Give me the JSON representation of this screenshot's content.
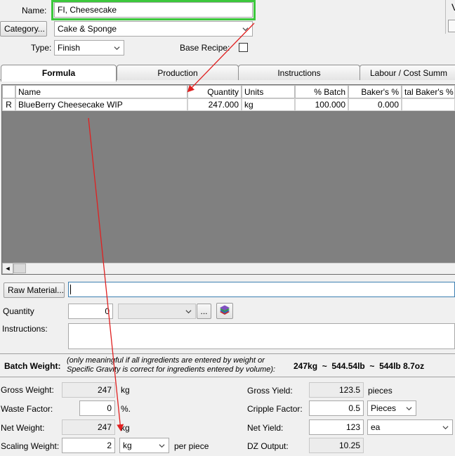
{
  "header": {
    "name_label": "Name:",
    "name_value": "FI, Cheesecake",
    "category_button": "Category...",
    "category_value": "Cake & Sponge",
    "type_label": "Type:",
    "type_value": "Finish",
    "base_recipe_label": "Base Recipe:",
    "base_recipe_checked": false
  },
  "tabs": [
    "Formula",
    "Production",
    "Instructions",
    "Labour / Cost Summ"
  ],
  "grid": {
    "columns": [
      "Name",
      "Quantity",
      "Units",
      "% Batch",
      "Baker's %",
      "tal Baker's %"
    ],
    "rows": [
      {
        "marker": "R",
        "name": "BlueBerry Cheesecake WIP",
        "quantity": "247.000",
        "units": "kg",
        "batch": "100.000",
        "bakers": "0.000",
        "total_bakers": ""
      }
    ],
    "scroll_left": "◄"
  },
  "entry": {
    "raw_material_button": "Raw Material...",
    "raw_material_value": "",
    "quantity_label": "Quantity",
    "quantity_value": "0",
    "unit_value": "",
    "ellipsis_button": "...",
    "instructions_label": "Instructions:",
    "instructions_value": ""
  },
  "batch": {
    "label": "Batch Weight:",
    "note_line1": "(only meaningful if all ingredients are entered by weight or",
    "note_line2": "Specific Gravity is correct for ingredients entered by volume):",
    "value": "247kg  ~  544.54lb  ~  544lb 8.7oz"
  },
  "weights": {
    "gross_weight_label": "Gross Weight:",
    "gross_weight_value": "247",
    "gross_weight_unit": "kg",
    "waste_factor_label": "Waste Factor:",
    "waste_factor_value": "0",
    "waste_factor_unit": "%.",
    "net_weight_label": "Net Weight:",
    "net_weight_value": "247",
    "net_weight_unit": "kg",
    "scaling_weight_label": "Scaling Weight:",
    "scaling_weight_value": "2",
    "scaling_weight_unit": "kg",
    "scaling_weight_suffix": "per piece"
  },
  "yields": {
    "gross_yield_label": "Gross Yield:",
    "gross_yield_value": "123.5",
    "gross_yield_unit": "pieces",
    "cripple_factor_label": "Cripple Factor:",
    "cripple_factor_value": "0.5",
    "cripple_factor_unit": "Pieces",
    "net_yield_label": "Net Yield:",
    "net_yield_value": "123",
    "net_yield_unit": "ea",
    "dz_output_label": "DZ Output:",
    "dz_output_value": "10.25"
  },
  "colors": {
    "highlight_border": "#3cc83c",
    "annotation_arrow": "#e02020",
    "grid_empty": "#808080"
  }
}
